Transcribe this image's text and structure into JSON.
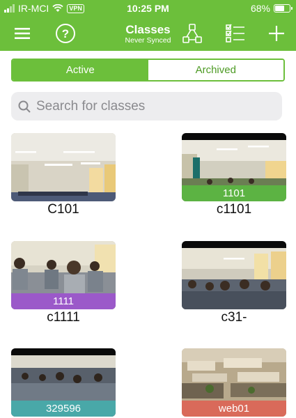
{
  "status_bar": {
    "carrier": "IR-MCI",
    "vpn": "VPN",
    "time": "10:25 PM",
    "battery": "68%",
    "battery_level": 0.68
  },
  "nav": {
    "title": "Classes",
    "subtitle": "Never Synced",
    "icons": [
      "menu-icon",
      "help-icon",
      "groups-icon",
      "checklist-icon",
      "add-icon"
    ]
  },
  "segments": {
    "active_label": "Active",
    "archived_label": "Archived",
    "selected": "Active"
  },
  "search": {
    "placeholder": "Search for classes",
    "value": ""
  },
  "colors": {
    "brand_green": "#6cbf3b",
    "band_green": "#5cb343",
    "band_purple": "#9b59c9",
    "band_teal": "#49a8a8",
    "band_red": "#d96a5a"
  },
  "classes": [
    {
      "name": "C101",
      "band_label": ""
    },
    {
      "name": "c1101",
      "band_label": "1101",
      "band_color": "#5cb343"
    },
    {
      "name": "c1111",
      "band_label": "1111",
      "band_color": "#9b59c9"
    },
    {
      "name": "c31-",
      "band_label": ""
    },
    {
      "name": "",
      "band_label": "329596",
      "band_color": "#49a8a8"
    },
    {
      "name": "",
      "band_label": "web01",
      "band_color": "#d96a5a"
    }
  ]
}
